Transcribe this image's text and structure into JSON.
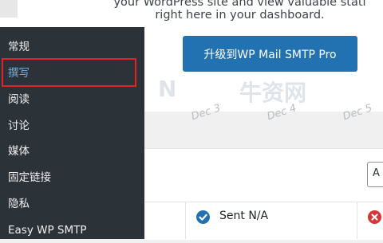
{
  "promo": {
    "line1": "your WordPress site and view valuable stati",
    "line2": "right here in your dashboard.",
    "upgrade_button": "升级到WP Mail SMTP Pro"
  },
  "watermark": {
    "text1": "网",
    "text2": "N",
    "text3": "牛资网"
  },
  "chart": {
    "axis_labels": [
      "Dec 3",
      "Dec 4",
      "Dec 5"
    ]
  },
  "sidebar": {
    "items": [
      {
        "label": "常规",
        "active": false
      },
      {
        "label": "撰写",
        "active": true
      },
      {
        "label": "阅读",
        "active": false
      },
      {
        "label": "讨论",
        "active": false
      },
      {
        "label": "媒体",
        "active": false
      },
      {
        "label": "固定链接",
        "active": false
      },
      {
        "label": "隐私",
        "active": false
      },
      {
        "label": "Easy WP SMTP",
        "active": false
      }
    ]
  },
  "table": {
    "select_value": "A",
    "sent_label": "Sent N/A"
  },
  "colors": {
    "sidebar_bg": "#2c3338",
    "active_link": "#72aee6",
    "primary_button": "#2271b1",
    "highlight_border": "#e0242a",
    "error": "#d63638"
  }
}
